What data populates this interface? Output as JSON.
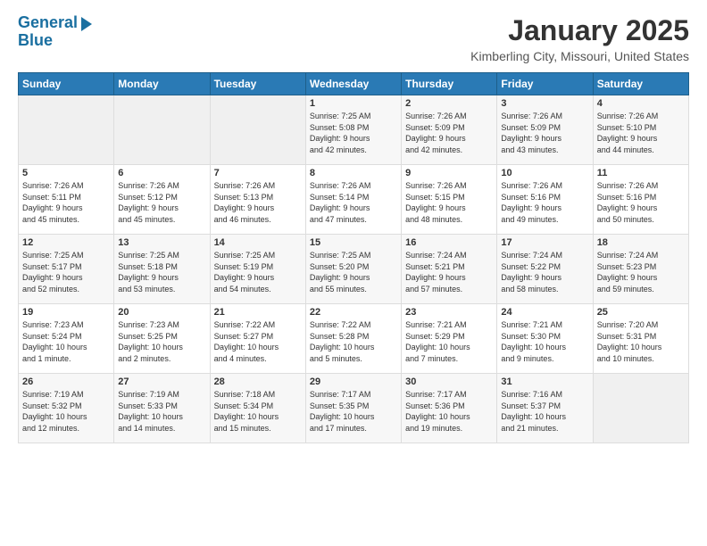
{
  "logo": {
    "line1": "General",
    "line2": "Blue"
  },
  "title": "January 2025",
  "subtitle": "Kimberling City, Missouri, United States",
  "headers": [
    "Sunday",
    "Monday",
    "Tuesday",
    "Wednesday",
    "Thursday",
    "Friday",
    "Saturday"
  ],
  "weeks": [
    [
      {
        "day": "",
        "info": ""
      },
      {
        "day": "",
        "info": ""
      },
      {
        "day": "",
        "info": ""
      },
      {
        "day": "1",
        "info": "Sunrise: 7:25 AM\nSunset: 5:08 PM\nDaylight: 9 hours\nand 42 minutes."
      },
      {
        "day": "2",
        "info": "Sunrise: 7:26 AM\nSunset: 5:09 PM\nDaylight: 9 hours\nand 42 minutes."
      },
      {
        "day": "3",
        "info": "Sunrise: 7:26 AM\nSunset: 5:09 PM\nDaylight: 9 hours\nand 43 minutes."
      },
      {
        "day": "4",
        "info": "Sunrise: 7:26 AM\nSunset: 5:10 PM\nDaylight: 9 hours\nand 44 minutes."
      }
    ],
    [
      {
        "day": "5",
        "info": "Sunrise: 7:26 AM\nSunset: 5:11 PM\nDaylight: 9 hours\nand 45 minutes."
      },
      {
        "day": "6",
        "info": "Sunrise: 7:26 AM\nSunset: 5:12 PM\nDaylight: 9 hours\nand 45 minutes."
      },
      {
        "day": "7",
        "info": "Sunrise: 7:26 AM\nSunset: 5:13 PM\nDaylight: 9 hours\nand 46 minutes."
      },
      {
        "day": "8",
        "info": "Sunrise: 7:26 AM\nSunset: 5:14 PM\nDaylight: 9 hours\nand 47 minutes."
      },
      {
        "day": "9",
        "info": "Sunrise: 7:26 AM\nSunset: 5:15 PM\nDaylight: 9 hours\nand 48 minutes."
      },
      {
        "day": "10",
        "info": "Sunrise: 7:26 AM\nSunset: 5:16 PM\nDaylight: 9 hours\nand 49 minutes."
      },
      {
        "day": "11",
        "info": "Sunrise: 7:26 AM\nSunset: 5:16 PM\nDaylight: 9 hours\nand 50 minutes."
      }
    ],
    [
      {
        "day": "12",
        "info": "Sunrise: 7:25 AM\nSunset: 5:17 PM\nDaylight: 9 hours\nand 52 minutes."
      },
      {
        "day": "13",
        "info": "Sunrise: 7:25 AM\nSunset: 5:18 PM\nDaylight: 9 hours\nand 53 minutes."
      },
      {
        "day": "14",
        "info": "Sunrise: 7:25 AM\nSunset: 5:19 PM\nDaylight: 9 hours\nand 54 minutes."
      },
      {
        "day": "15",
        "info": "Sunrise: 7:25 AM\nSunset: 5:20 PM\nDaylight: 9 hours\nand 55 minutes."
      },
      {
        "day": "16",
        "info": "Sunrise: 7:24 AM\nSunset: 5:21 PM\nDaylight: 9 hours\nand 57 minutes."
      },
      {
        "day": "17",
        "info": "Sunrise: 7:24 AM\nSunset: 5:22 PM\nDaylight: 9 hours\nand 58 minutes."
      },
      {
        "day": "18",
        "info": "Sunrise: 7:24 AM\nSunset: 5:23 PM\nDaylight: 9 hours\nand 59 minutes."
      }
    ],
    [
      {
        "day": "19",
        "info": "Sunrise: 7:23 AM\nSunset: 5:24 PM\nDaylight: 10 hours\nand 1 minute."
      },
      {
        "day": "20",
        "info": "Sunrise: 7:23 AM\nSunset: 5:25 PM\nDaylight: 10 hours\nand 2 minutes."
      },
      {
        "day": "21",
        "info": "Sunrise: 7:22 AM\nSunset: 5:27 PM\nDaylight: 10 hours\nand 4 minutes."
      },
      {
        "day": "22",
        "info": "Sunrise: 7:22 AM\nSunset: 5:28 PM\nDaylight: 10 hours\nand 5 minutes."
      },
      {
        "day": "23",
        "info": "Sunrise: 7:21 AM\nSunset: 5:29 PM\nDaylight: 10 hours\nand 7 minutes."
      },
      {
        "day": "24",
        "info": "Sunrise: 7:21 AM\nSunset: 5:30 PM\nDaylight: 10 hours\nand 9 minutes."
      },
      {
        "day": "25",
        "info": "Sunrise: 7:20 AM\nSunset: 5:31 PM\nDaylight: 10 hours\nand 10 minutes."
      }
    ],
    [
      {
        "day": "26",
        "info": "Sunrise: 7:19 AM\nSunset: 5:32 PM\nDaylight: 10 hours\nand 12 minutes."
      },
      {
        "day": "27",
        "info": "Sunrise: 7:19 AM\nSunset: 5:33 PM\nDaylight: 10 hours\nand 14 minutes."
      },
      {
        "day": "28",
        "info": "Sunrise: 7:18 AM\nSunset: 5:34 PM\nDaylight: 10 hours\nand 15 minutes."
      },
      {
        "day": "29",
        "info": "Sunrise: 7:17 AM\nSunset: 5:35 PM\nDaylight: 10 hours\nand 17 minutes."
      },
      {
        "day": "30",
        "info": "Sunrise: 7:17 AM\nSunset: 5:36 PM\nDaylight: 10 hours\nand 19 minutes."
      },
      {
        "day": "31",
        "info": "Sunrise: 7:16 AM\nSunset: 5:37 PM\nDaylight: 10 hours\nand 21 minutes."
      },
      {
        "day": "",
        "info": ""
      }
    ]
  ]
}
